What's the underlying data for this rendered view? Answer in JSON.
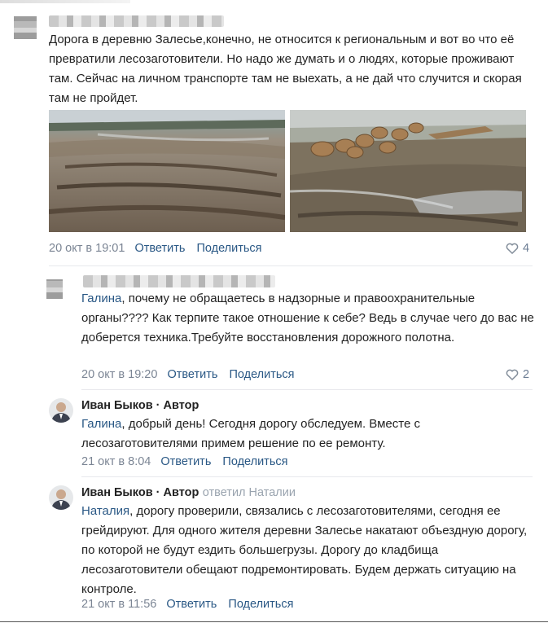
{
  "post": {
    "text": "Дорога в деревню Залесье,конечно, не относится к региональным и вот во что её превратили лесозаготовители. Но надо же думать и о людях, которые проживают там. Сейчас на личном транспорте там не выехать, а не дай что случится и скорая там не пройдет.",
    "date": "20 окт в 19:01",
    "reply_label": "Ответить",
    "share_label": "Поделиться",
    "likes": "4"
  },
  "comment1": {
    "mention": "Галина",
    "text": ", почему не обращаетесь в надзорные и правоохранительные органы???? Как терпите такое отношение к себе? Ведь в случае чего до вас не доберется техника.Требуйте восстановления дорожного полотна.",
    "date": "20 окт в 19:20",
    "reply_label": "Ответить",
    "share_label": "Поделиться",
    "likes": "2"
  },
  "comment2": {
    "author": "Иван Быков · Автор",
    "mention": "Галина",
    "text": ", добрый день! Сегодня дорогу обследуем. Вместе с лесозаготовителями примем решение по ее ремонту.",
    "date": "21 окт в 8:04",
    "reply_label": "Ответить",
    "share_label": "Поделиться"
  },
  "comment3": {
    "author": "Иван Быков · Автор",
    "replied_to": "ответил Наталии",
    "mention": "Наталия",
    "text": ", дорогу проверили, связались с лесозаготовителями, сегодня ее грейдируют. Для одного жителя деревни Залесье накатают объездную дорогу, по которой не будут ездить большегрузы. Дорогу до кладбища лесозаготовители обещают подремонтировать. Будем держать ситуацию на контроле.",
    "date": "21 окт в 11:56",
    "reply_label": "Ответить",
    "share_label": "Поделиться"
  },
  "colors": {
    "link": "#2a5885",
    "meta": "#7b8594",
    "separator": "#e7e8ec"
  }
}
